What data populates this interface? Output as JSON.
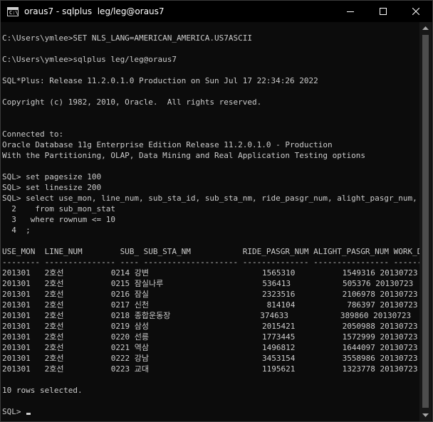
{
  "window": {
    "title": "oraus7 - sqlplus  leg/leg@oraus7",
    "icon": "console-icon",
    "icon_glyph": "C:\\"
  },
  "controls": {
    "minimize": "minimize-icon",
    "maximize": "maximize-icon",
    "close": "close-icon"
  },
  "console": {
    "lines": [
      "C:\\Users\\ymlee>SET NLS_LANG=AMERICAN_AMERICA.US7ASCII",
      "C:\\Users\\ymlee>sqlplus leg/leg@oraus7",
      "SQL*Plus: Release 11.2.0.1.0 Production on Sun Jul 17 22:34:26 2022",
      "Copyright (c) 1982, 2010, Oracle.  All rights reserved.",
      "Connected to:",
      "Oracle Database 11g Enterprise Edition Release 11.2.0.1.0 - Production",
      "With the Partitioning, OLAP, Data Mining and Real Application Testing options",
      "SQL> set pagesize 100",
      "SQL> set linesize 200",
      "SQL> select use_mon, line_num, sub_sta_id, sub_sta_nm, ride_pasgr_num, alight_pasgr_num, work_dt",
      "  2    from sub_mon_stat",
      "  3   where rownum <= 10",
      "  4  ;",
      "USE_MON  LINE_NUM        SUB_ SUB_STA_NM           RIDE_PASGR_NUM ALIGHT_PASGR_NUM WORK_DT",
      "-------- --------------- ---- -------------------- -------------- ---------------- --------",
      "201301   2호선          0214 강변                        1565310          1549316 20130723",
      "201301   2호선          0215 잠실나루                     536413           505376 20130723",
      "201301   2호선          0216 잠실                        2323516          2106978 20130723",
      "201301   2호선          0217 신천                         814104           786397 20130723",
      "201301   2호선          0218 종합운동장                   374633           389860 20130723",
      "201301   2호선          0219 삼성                        2015421          2050988 20130723",
      "201301   2호선          0220 선릉                        1773445          1572999 20130723",
      "201301   2호선          0221 역삼                        1496812          1644097 20130723",
      "201301   2호선          0222 강남                        3453154          3558986 20130723",
      "201301   2호선          0223 교대                        1195621          1323778 20130723",
      "10 rows selected.",
      "SQL> "
    ]
  },
  "scrollbar": {
    "up": "scroll-up-arrow-icon",
    "down": "scroll-down-arrow-icon"
  }
}
